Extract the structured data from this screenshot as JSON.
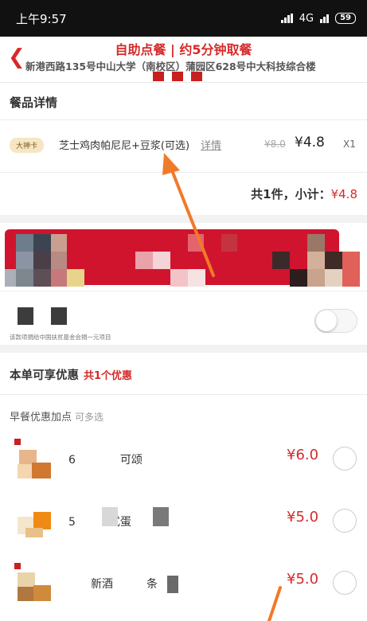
{
  "status_bar": {
    "time": "上午9:57",
    "network": "4G",
    "battery": "59"
  },
  "header": {
    "back_icon": "chevron-left-icon",
    "title": "自助点餐 | 约5分钟取餐",
    "address": "新港西路135号中山大学（南校区）蒲园区628号中大科技综合楼"
  },
  "detail": {
    "section_title": "餐品详情",
    "badge": "大神卡",
    "item_name": "芝士鸡肉帕尼尼+豆浆(可选)",
    "detail_link": "详情",
    "old_price": "¥8.0",
    "new_price": "¥4.8",
    "qty": "X1",
    "summary_label": "共1件，小计：",
    "summary_price": "¥4.8"
  },
  "donation": {
    "note": "该款项捐给中国扶贫基金会捐一元项目",
    "enabled": false
  },
  "offers": {
    "title": "本单可享优惠",
    "count": "共1个优惠",
    "sub_title": "早餐优惠加点",
    "sub_hint": "可多选",
    "items": [
      {
        "name": "6　　　　可颂",
        "price": "¥6.0"
      },
      {
        "name": "5　　　式蛋",
        "price": "¥5.0"
      },
      {
        "name": "　　新酒　　　条",
        "price": "¥5.0"
      }
    ]
  },
  "colors": {
    "accent": "#d62a2a",
    "annotation_arrow": "#f07a2a"
  }
}
